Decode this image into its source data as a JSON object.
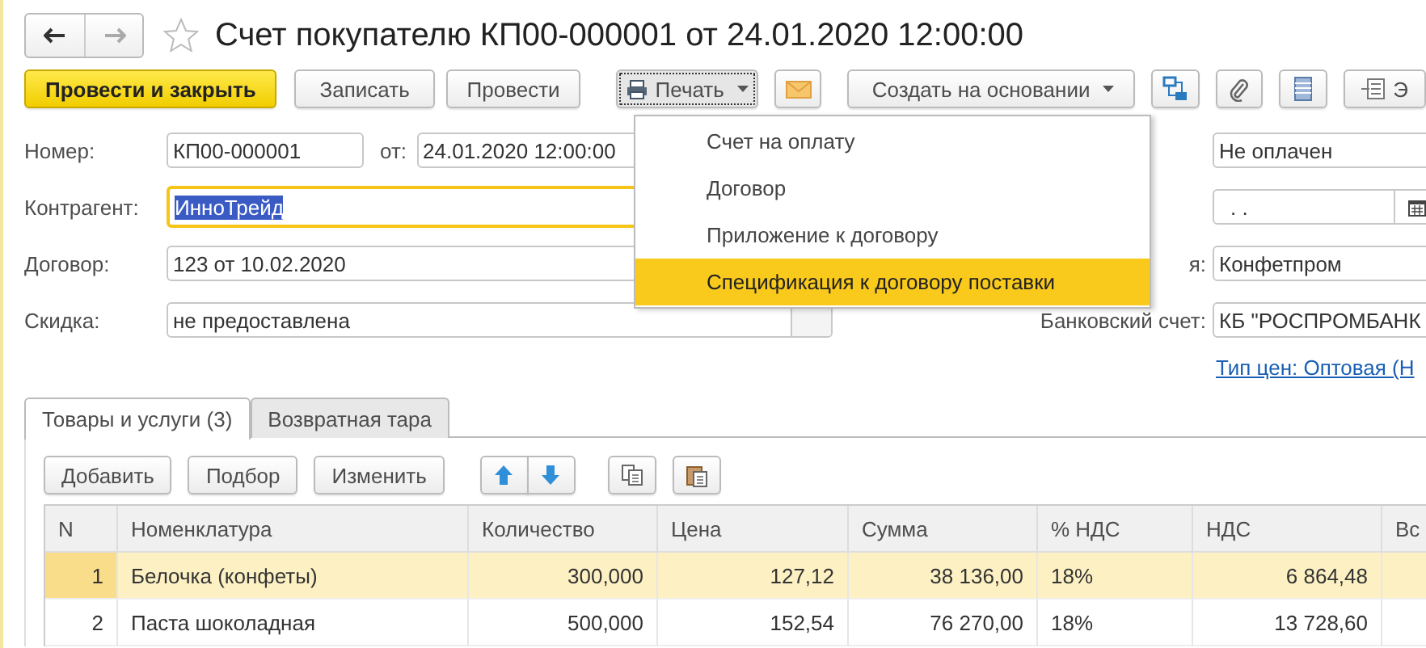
{
  "window": {
    "title": "Счет покупателю КП00-000001 от 24.01.2020 12:00:00",
    "favorite": false
  },
  "toolbar": [
    {
      "kind": "primary",
      "label": "Провести и закрыть"
    },
    {
      "kind": "text",
      "label": "Записать"
    },
    {
      "kind": "text",
      "label": "Провести"
    },
    {
      "kind": "print",
      "label": "Печать",
      "pressed": true
    },
    {
      "kind": "mail"
    },
    {
      "kind": "menu",
      "label": "Создать на основании"
    },
    {
      "kind": "structure"
    },
    {
      "kind": "attach"
    },
    {
      "kind": "list"
    },
    {
      "kind": "more",
      "label": "Э"
    }
  ],
  "print_menu": [
    {
      "label": "Счет на оплату",
      "selected": false
    },
    {
      "label": "Договор",
      "selected": false
    },
    {
      "label": "Приложение к договору",
      "selected": false
    },
    {
      "label": "Спецификация к договору поставки",
      "selected": true
    }
  ],
  "form_left": {
    "number_label": "Номер:",
    "number": "КП00-000001",
    "date_label": "от:",
    "date": "24.01.2020 12:00:00",
    "counterparty_label": "Контрагент:",
    "counterparty": "ИнноТрейд",
    "counterparty_focused": true,
    "contract_label": "Договор:",
    "contract": "123 от 10.02.2020",
    "discount_label": "Скидка:",
    "discount": "не предоставлена"
  },
  "form_right": {
    "status": "Не оплачен",
    "payment_date": ".  .",
    "consignee_label": "я:",
    "consignee": "Конфетпром",
    "bank_label": "Банковский счет:",
    "bank": "КБ \"РОСПРОМБАНК",
    "price_type_link": "Тип цен: Оптовая (Н"
  },
  "tabs": [
    {
      "label": "Товары и услуги (3)",
      "selected": true
    },
    {
      "label": "Возвратная тара",
      "selected": false
    }
  ],
  "table_toolbar": [
    {
      "kind": "text",
      "label": "Добавить"
    },
    {
      "kind": "text",
      "label": "Подбор"
    },
    {
      "kind": "text",
      "label": "Изменить"
    },
    {
      "kind": "up"
    },
    {
      "kind": "down"
    },
    {
      "kind": "copy"
    },
    {
      "kind": "paste"
    }
  ],
  "table": {
    "columns": [
      "N",
      "Номенклатура",
      "Количество",
      "Цена",
      "Сумма",
      "% НДС",
      "НДС",
      "Вс"
    ],
    "rows": [
      {
        "selected": true,
        "cells": [
          "1",
          "Белочка (конфеты)",
          "300,000",
          "127,12",
          "38 136,00",
          "18%",
          "6 864,48"
        ]
      },
      {
        "selected": false,
        "cells": [
          "2",
          "Паста шоколадная",
          "500,000",
          "152,54",
          "76 270,00",
          "18%",
          "13 728,60"
        ]
      }
    ]
  }
}
